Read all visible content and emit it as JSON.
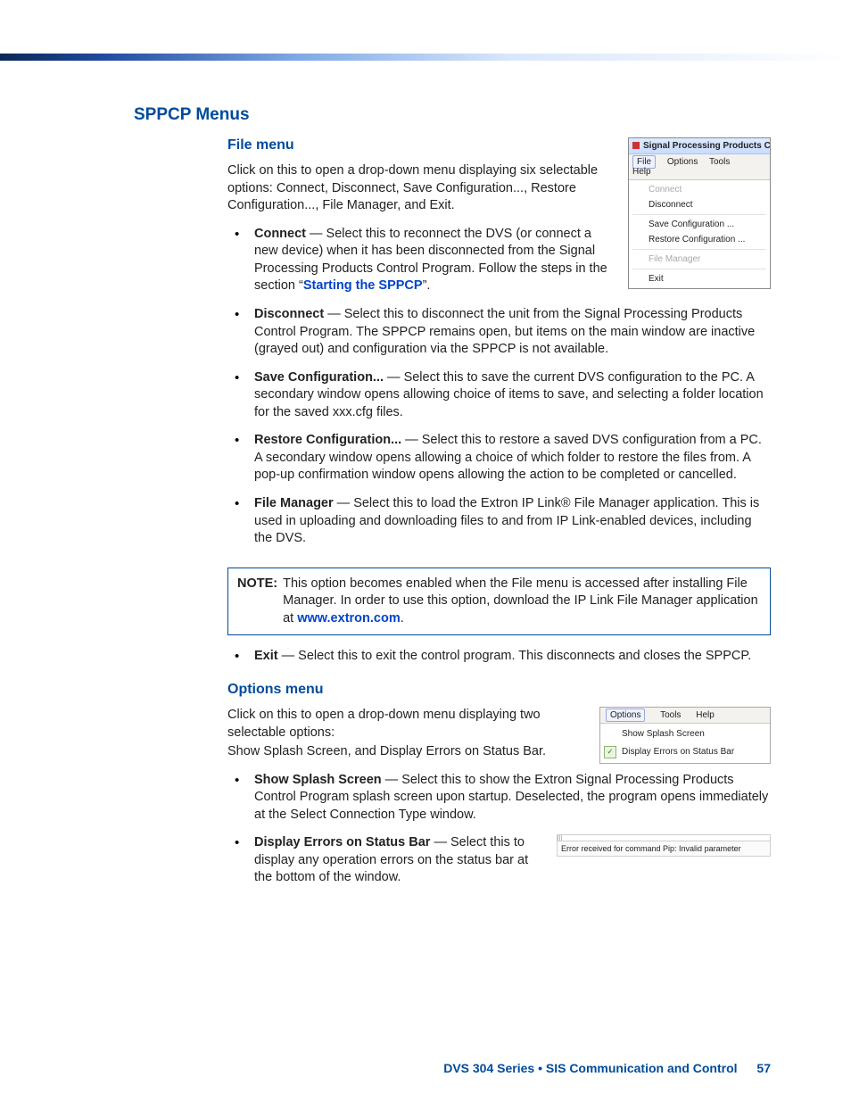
{
  "heading": "SPPCP Menus",
  "file_section": {
    "title": "File menu",
    "intro": "Click on this to open a drop-down menu displaying six selectable options:  Connect, Disconnect, Save Configuration..., Restore Configuration..., File Manager, and Exit.",
    "items": [
      {
        "term": "Connect",
        "text_before": " — Select this to reconnect the DVS (or connect a new device) when it has been disconnected from the Signal Processing Products Control Program. Follow the steps in the section “",
        "link": "Starting the SPPCP",
        "text_after": "”."
      },
      {
        "term": "Disconnect",
        "text": " — Select this to disconnect the unit from the Signal Processing Products Control Program. The SPPCP remains open, but items on the main window are inactive (grayed out) and configuration via the SPPCP is not available."
      },
      {
        "term": "Save Configuration...",
        "text": " — Select this to save the current DVS configuration to the PC. A secondary window opens allowing choice of items to save, and selecting a folder location for the saved xxx.cfg files."
      },
      {
        "term": "Restore Configuration...",
        "text": " — Select this to restore a saved DVS configuration from a PC. A secondary window opens allowing a choice of which folder to restore the files from. A pop-up confirmation window opens allowing the action to be completed or cancelled."
      },
      {
        "term": "File Manager",
        "text": " — Select this to load the Extron IP Link® File Manager application. This is used in uploading and downloading files to and from IP Link-enabled devices, including the DVS."
      }
    ],
    "note": {
      "label": "NOTE:",
      "text_before": "This option becomes enabled when the File menu is accessed after installing File Manager. In order to use this option, download the IP Link File Manager application at ",
      "link": "www.extron.com",
      "text_after": "."
    },
    "exit_item": {
      "term": "Exit",
      "text": " — Select this to exit the control program. This disconnects and closes the SPPCP."
    }
  },
  "options_section": {
    "title": "Options menu",
    "intro1": "Click on this to open a drop-down menu displaying two selectable options:",
    "intro2": "Show Splash Screen, and Display Errors on Status Bar.",
    "items": [
      {
        "term": "Show Splash Screen",
        "text": " — Select this to show the Extron Signal Processing Products Control Program splash screen upon startup. Deselected, the program opens immediately at the Select Connection Type window."
      },
      {
        "term": "Display Errors on Status Bar",
        "text": " — Select this to display any operation errors on the status bar at the bottom of the window."
      }
    ]
  },
  "fig_file": {
    "title": "Signal Processing Products Con",
    "menubar": [
      "File",
      "Options",
      "Tools",
      "Help"
    ],
    "rows": [
      {
        "label": "Connect",
        "disabled": true
      },
      {
        "label": "Disconnect",
        "disabled": false
      },
      {
        "sep": true
      },
      {
        "label": "Save Configuration ...",
        "disabled": false
      },
      {
        "label": "Restore Configuration ...",
        "disabled": false
      },
      {
        "sep": true
      },
      {
        "label": "File Manager",
        "disabled": true
      },
      {
        "sep": true
      },
      {
        "label": "Exit",
        "disabled": false
      }
    ]
  },
  "fig_opt": {
    "menubar": [
      "Options",
      "Tools",
      "Help"
    ],
    "rows": [
      {
        "label": "Show Splash Screen",
        "checked": false
      },
      {
        "label": "Display Errors on Status Bar",
        "checked": true
      }
    ]
  },
  "fig_status": {
    "text": "Error received for command Pip: Invalid parameter"
  },
  "footer": {
    "text": "DVS 304 Series • SIS Communication and Control",
    "page": "57"
  }
}
